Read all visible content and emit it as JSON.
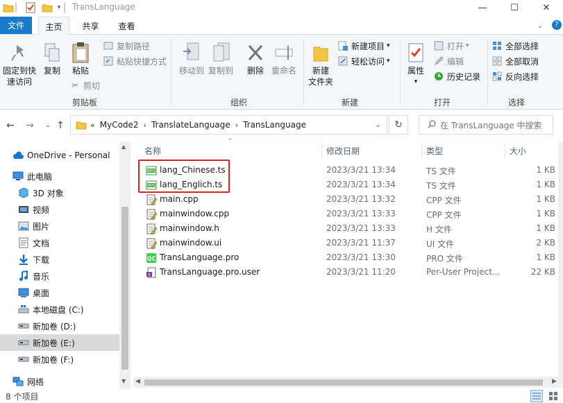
{
  "window": {
    "title": "TransLanguage",
    "minimize_glyph": "—",
    "maximize_glyph": "☐",
    "close_glyph": "✕"
  },
  "tabs": {
    "file": "文件",
    "home": "主页",
    "share": "共享",
    "view": "查看",
    "help": "?"
  },
  "ribbon": {
    "clipboard": {
      "pin": "固定到快\n速访问",
      "copy": "复制",
      "paste": "粘贴",
      "copy_path": "复制路径",
      "paste_shortcut": "粘贴快捷方式",
      "cut": "剪切",
      "group": "剪贴板"
    },
    "organize": {
      "move_to": "移动到",
      "copy_to": "复制到",
      "delete": "删除",
      "rename": "重命名",
      "group": "组织"
    },
    "new": {
      "new_folder": "新建\n文件夹",
      "new_item": "新建项目",
      "easy_access": "轻松访问",
      "group": "新建"
    },
    "open": {
      "properties": "属性",
      "open": "打开",
      "edit": "编辑",
      "history": "历史记录",
      "group": "打开"
    },
    "select": {
      "select_all": "全部选择",
      "select_none": "全部取消",
      "invert": "反向选择",
      "group": "选择"
    }
  },
  "nav": {
    "overflow": "«",
    "crumbs": [
      "MyCode2",
      "TranslateLanguage",
      "TransLanguage"
    ],
    "search_placeholder": "在 TransLanguage 中搜索"
  },
  "sidebar": {
    "items": [
      {
        "label": "OneDrive - Personal",
        "icon": "cloud-icon"
      },
      {
        "label": "此电脑",
        "icon": "computer-icon"
      },
      {
        "label": "3D 对象",
        "icon": "cube-icon"
      },
      {
        "label": "视频",
        "icon": "video-icon"
      },
      {
        "label": "图片",
        "icon": "picture-icon"
      },
      {
        "label": "文档",
        "icon": "document-icon"
      },
      {
        "label": "下载",
        "icon": "download-icon"
      },
      {
        "label": "音乐",
        "icon": "music-icon"
      },
      {
        "label": "桌面",
        "icon": "desktop-icon"
      },
      {
        "label": "本地磁盘 (C:)",
        "icon": "windows-drive-icon"
      },
      {
        "label": "新加卷 (D:)",
        "icon": "drive-icon"
      },
      {
        "label": "新加卷 (E:)",
        "icon": "drive-icon"
      },
      {
        "label": "新加卷 (F:)",
        "icon": "drive-icon"
      },
      {
        "label": "网络",
        "icon": "network-icon"
      }
    ]
  },
  "columns": {
    "name": "名称",
    "date": "修改日期",
    "type": "类型",
    "size": "大小"
  },
  "files": [
    {
      "name": "lang_Chinese.ts",
      "date": "2023/3/21 13:34",
      "type": "TS 文件",
      "size": "1 KB",
      "icon": "ts-file-icon"
    },
    {
      "name": "lang_Englich.ts",
      "date": "2023/3/21 13:34",
      "type": "TS 文件",
      "size": "1 KB",
      "icon": "ts-file-icon"
    },
    {
      "name": "main.cpp",
      "date": "2023/3/21 13:32",
      "type": "CPP 文件",
      "size": "1 KB",
      "icon": "text-file-icon"
    },
    {
      "name": "mainwindow.cpp",
      "date": "2023/3/21 13:33",
      "type": "CPP 文件",
      "size": "1 KB",
      "icon": "text-file-icon"
    },
    {
      "name": "mainwindow.h",
      "date": "2023/3/21 13:33",
      "type": "H 文件",
      "size": "1 KB",
      "icon": "text-file-icon"
    },
    {
      "name": "mainwindow.ui",
      "date": "2023/3/21 11:37",
      "type": "UI 文件",
      "size": "2 KB",
      "icon": "text-file-icon"
    },
    {
      "name": "TransLanguage.pro",
      "date": "2023/3/21 13:30",
      "type": "PRO 文件",
      "size": "1 KB",
      "icon": "qt-project-icon"
    },
    {
      "name": "TransLanguage.pro.user",
      "date": "2023/3/21 11:20",
      "type": "Per-User Project...",
      "size": "22 KB",
      "icon": "xml-file-icon"
    }
  ],
  "status": {
    "count": "8 个项目"
  }
}
